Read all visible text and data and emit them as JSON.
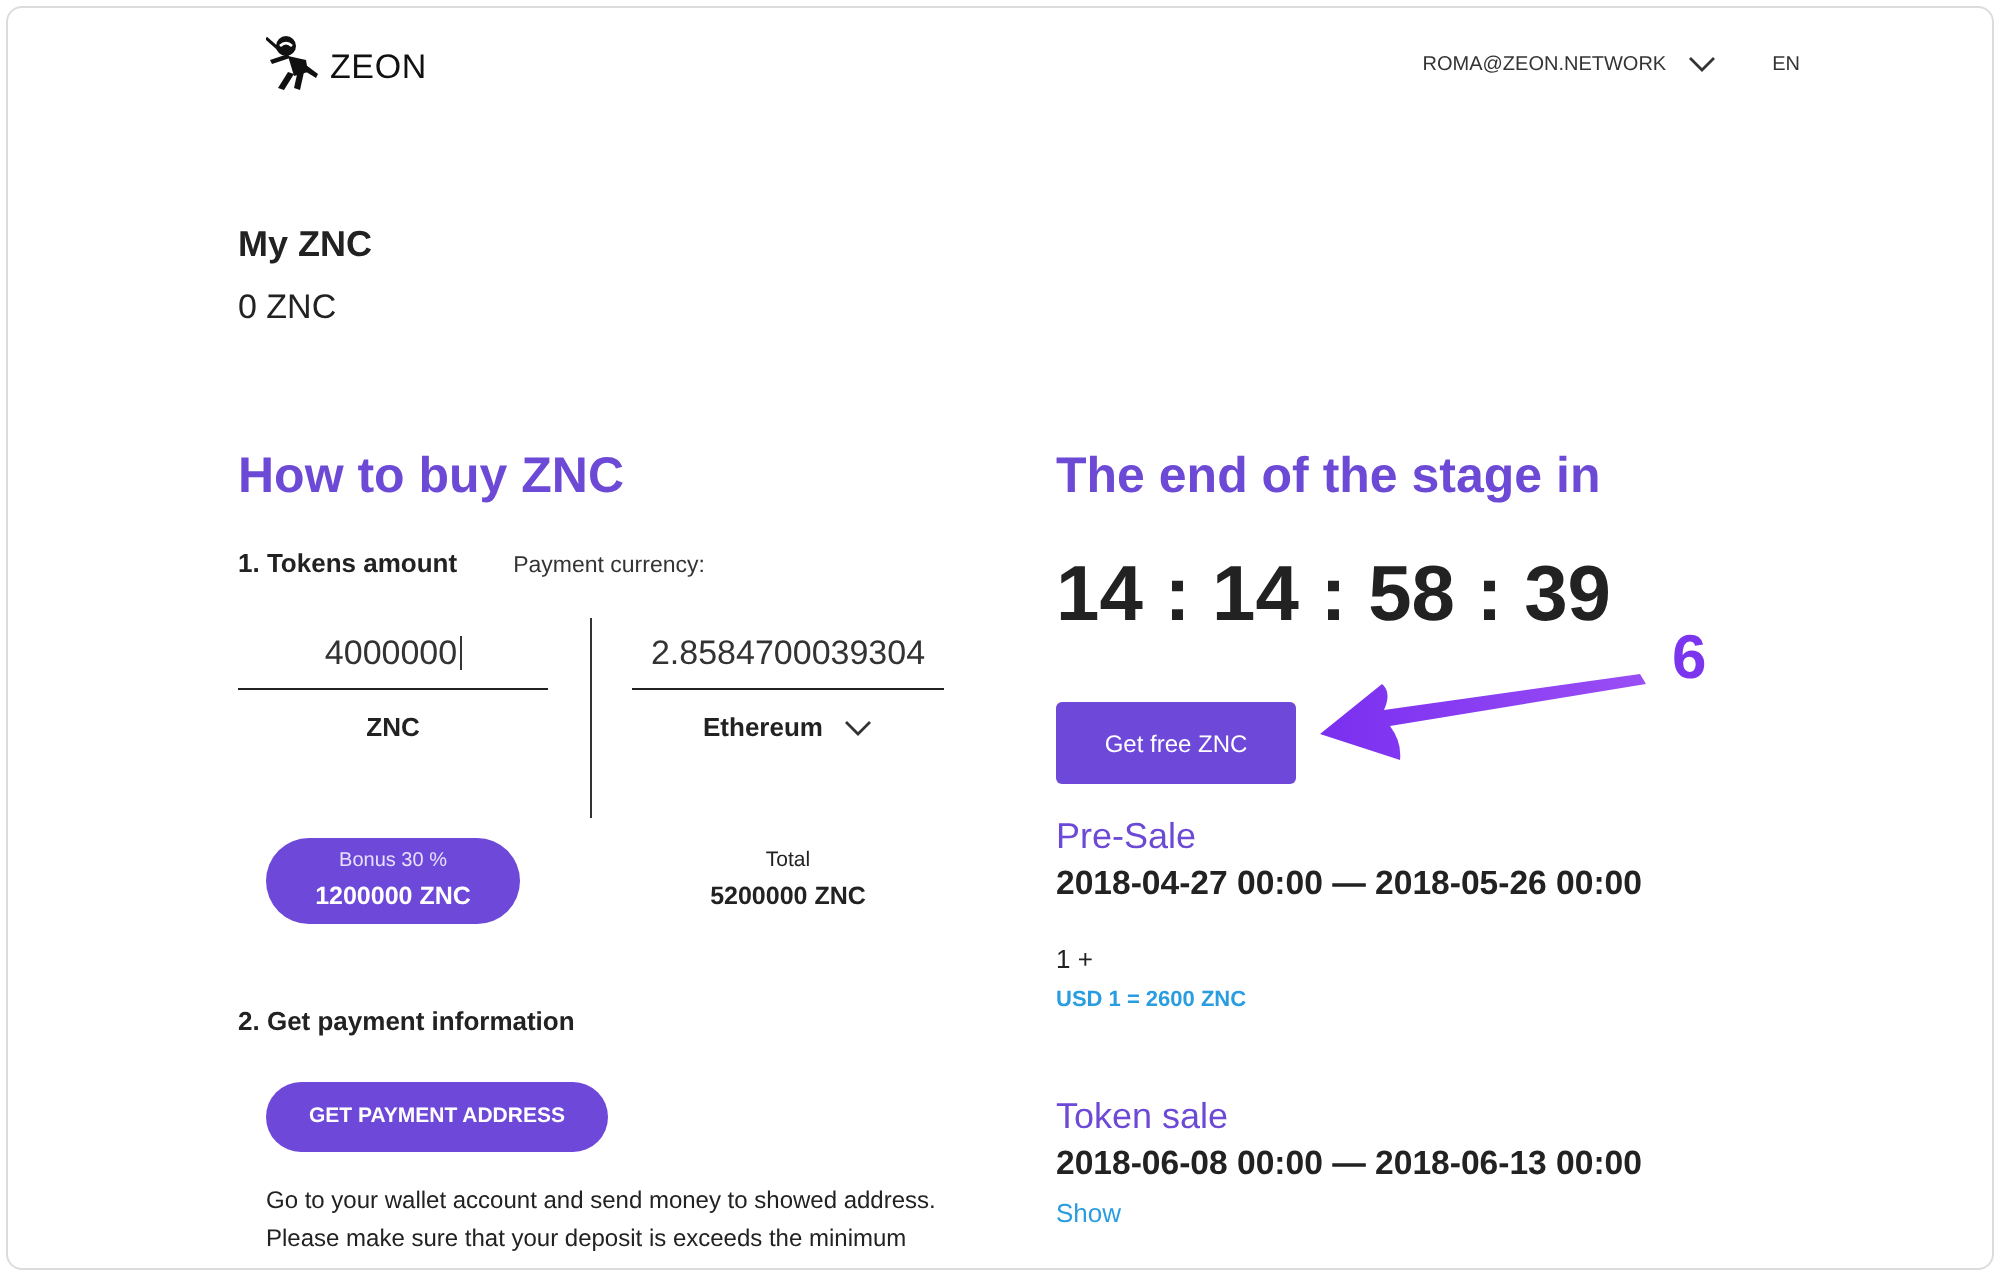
{
  "header": {
    "logo_text": "ZEON",
    "account": "ROMA@ZEON.NETWORK",
    "language": "EN"
  },
  "balance": {
    "title": "My ZNC",
    "amount": "0 ZNC"
  },
  "buy": {
    "title": "How to buy ZNC",
    "step_1": {
      "label": "1. Tokens amount",
      "currency_label": "Payment currency:"
    },
    "fields": [
      {
        "kind": "text",
        "value": "4000000",
        "focused": true,
        "unit": "ZNC"
      },
      {
        "kind": "select",
        "value": "2.8584700039304",
        "focused": false,
        "unit": "Ethereum"
      }
    ],
    "bonus": {
      "label": "Bonus 30 %",
      "amount": "1200000 ZNC"
    },
    "total": {
      "label": "Total",
      "amount": "5200000 ZNC"
    },
    "step_2": {
      "label": "2. Get payment information",
      "button": "GET PAYMENT ADDRESS",
      "note": "Go to your wallet account and send money to showed address. Please make sure that your deposit is exceeds the minimum"
    }
  },
  "stage": {
    "title": "The end of the stage in",
    "countdown": "14 : 14 : 58 : 39",
    "button": "Get free ZNC",
    "annotation": {
      "label": "6"
    },
    "periods": [
      {
        "name": "Pre-Sale",
        "dates": "2018-04-27 00:00 — 2018-05-26 00:00",
        "tier": "1 +",
        "rate": "USD 1 = 2600 ZNC"
      },
      {
        "name": "Token sale",
        "dates": "2018-06-08 00:00 — 2018-06-13 00:00",
        "link": "Show"
      }
    ]
  }
}
